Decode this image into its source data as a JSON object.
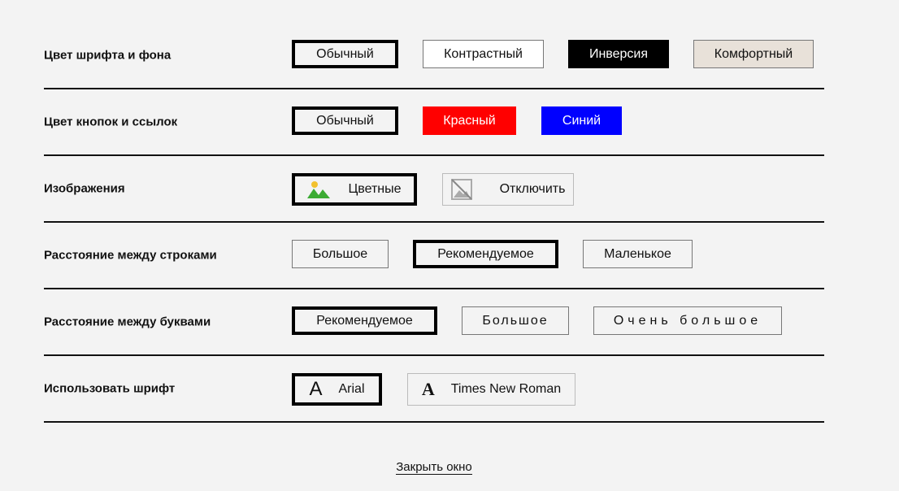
{
  "rows": [
    {
      "label": "Цвет шрифта и фона",
      "options": [
        "Обычный",
        "Контрастный",
        "Инверсия",
        "Комфортный"
      ]
    },
    {
      "label": "Цвет кнопок и ссылок",
      "options": [
        "Обычный",
        "Красный",
        "Синий"
      ]
    },
    {
      "label": "Изображения",
      "options": [
        "Цветные",
        "Отключить"
      ]
    },
    {
      "label": "Расстояние между строками",
      "options": [
        "Большое",
        "Рекомендуемое",
        "Маленькое"
      ]
    },
    {
      "label": "Расстояние между буквами",
      "options": [
        "Рекомендуемое",
        "Большое",
        "Очень большое"
      ]
    },
    {
      "label": "Использовать шрифт",
      "options": [
        "Arial",
        "Times New Roman"
      ]
    }
  ],
  "close_label": "Закрыть окно",
  "colors": {
    "red": "#ff0000",
    "blue": "#0000ff",
    "inverse": "#000000",
    "comfort": "#e8e1d9"
  },
  "font_icon_glyph": "A"
}
